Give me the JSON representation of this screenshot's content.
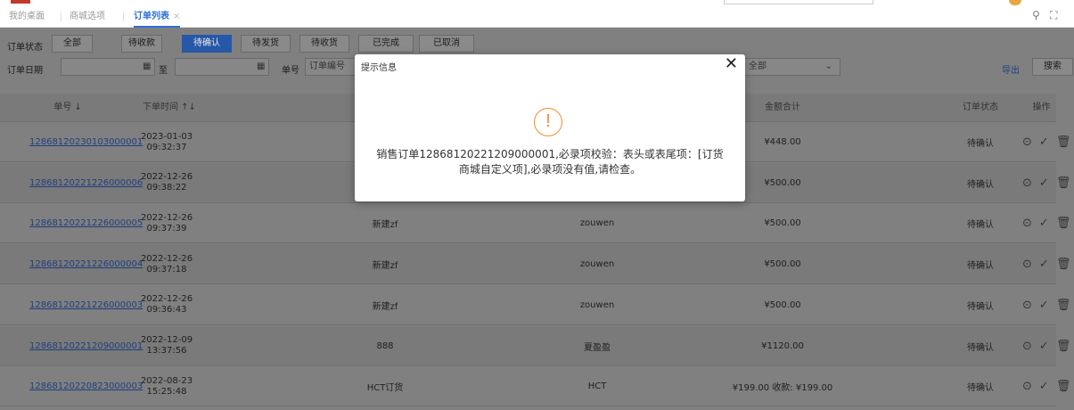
{
  "tabs": [
    {
      "label": "我的桌面"
    },
    {
      "label": "商城选项"
    },
    {
      "label": "订单列表",
      "close": "×"
    }
  ],
  "tools": {
    "search": "⚲",
    "fullscreen": "⛶"
  },
  "filters": {
    "status_label": "订单状态",
    "status_buttons": [
      "全部",
      "待收款",
      "待确认",
      "待发货",
      "待收货",
      "已完成",
      "已取消"
    ],
    "active_status": "待确认",
    "date_label": "订单日期",
    "date_to": "至",
    "order_no_label": "单号",
    "order_no_placeholder": "订单编号",
    "state_select_value": "全部",
    "export_label": "导出",
    "search_label": "搜索"
  },
  "table": {
    "headers": {
      "order_no": "单号 ↓",
      "time": "下单时间 ↑↓",
      "total": "金额合计",
      "status": "订单状态",
      "actions": "操作"
    },
    "rows": [
      {
        "order_no": "12868120230103000001",
        "date": "2023-01-03",
        "time": "09:32:37",
        "name": "",
        "user": "",
        "amount": "¥448.00",
        "status": "待确认"
      },
      {
        "order_no": "12868120221226000006",
        "date": "2022-12-26",
        "time": "09:38:22",
        "name": "",
        "user": "",
        "amount": "¥500.00",
        "status": "待确认"
      },
      {
        "order_no": "12868120221226000005",
        "date": "2022-12-26",
        "time": "09:37:39",
        "name": "新建zf",
        "user": "zouwen",
        "amount": "¥500.00",
        "status": "待确认"
      },
      {
        "order_no": "12868120221226000004",
        "date": "2022-12-26",
        "time": "09:37:18",
        "name": "新建zf",
        "user": "zouwen",
        "amount": "¥500.00",
        "status": "待确认"
      },
      {
        "order_no": "12868120221226000003",
        "date": "2022-12-26",
        "time": "09:36:43",
        "name": "新建zf",
        "user": "zouwen",
        "amount": "¥500.00",
        "status": "待确认"
      },
      {
        "order_no": "12868120221209000001",
        "date": "2022-12-09",
        "time": "13:37:56",
        "name": "888",
        "user": "夏盈盈",
        "amount": "¥1120.00",
        "status": "待确认"
      },
      {
        "order_no": "12868120220823000003",
        "date": "2022-08-23",
        "time": "15:25:48",
        "name": "HCT订货",
        "user": "HCT",
        "amount": "¥199.00 收款: ¥199.00",
        "status": "待确认"
      }
    ]
  },
  "modal": {
    "title": "提示信息",
    "close": "✕",
    "icon": "!",
    "message": "销售订单12868120221209000001,必录项校验：表头或表尾项：[订货商城自定义项],必录项没有值,请检查。"
  },
  "icons": {
    "view": "⊙",
    "confirm": "✓",
    "delete": "🗑"
  },
  "colors": {
    "accent": "#2f6fd6",
    "warning": "#f08c2c"
  }
}
